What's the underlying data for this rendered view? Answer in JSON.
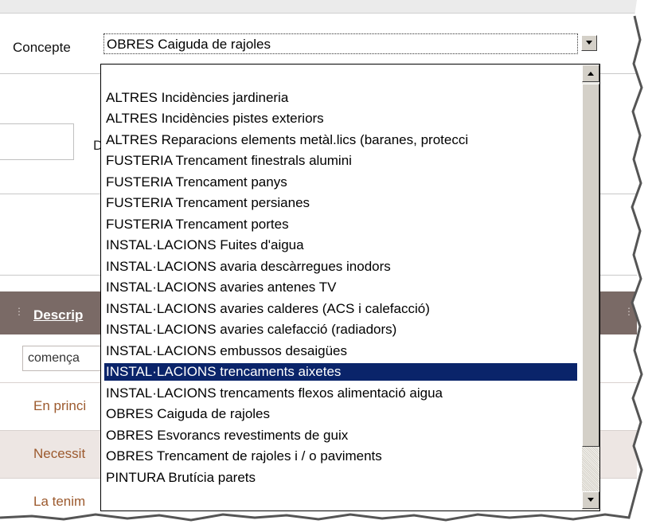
{
  "form": {
    "concept_label": "Concepte",
    "concept_value": "OBRES Caiguda de rajoles",
    "partial_label": "D"
  },
  "dropdown": {
    "options": [
      "",
      "ALTRES Incidències jardineria",
      "ALTRES Incidències pistes exteriors",
      "ALTRES Reparacions elements metàl.lics (baranes, protecci",
      "FUSTERIA Trencament finestrals alumini",
      "FUSTERIA Trencament panys",
      "FUSTERIA Trencament persianes",
      "FUSTERIA Trencament portes",
      "INSTAL·LACIONS Fuites d'aigua",
      "INSTAL·LACIONS avaria descàrregues inodors",
      "INSTAL·LACIONS avaries antenes TV",
      "INSTAL·LACIONS avaries calderes (ACS i calefacció)",
      "INSTAL·LACIONS avaries calefacció (radiadors)",
      "INSTAL·LACIONS embussos desaigües",
      "INSTAL·LACIONS trencaments aixetes",
      "INSTAL·LACIONS trencaments flexos alimentació aigua",
      "OBRES Caiguda de rajoles",
      "OBRES Esvorancs revestiments de guix",
      "OBRES Trencament de rajoles i / o paviments",
      "PINTURA Brutícia parets"
    ],
    "selected_index": 14,
    "scroll_up_icon": "triangle-up-icon",
    "scroll_down_icon": "triangle-down-icon"
  },
  "grid": {
    "column_header": "Descrip",
    "filter_value": "comença",
    "rows": [
      "En princi",
      "Necessit",
      "La tenim"
    ]
  },
  "colors": {
    "selection": "#0a246a",
    "grid_header": "#7a6a66",
    "row_text": "#9c5a2e"
  }
}
